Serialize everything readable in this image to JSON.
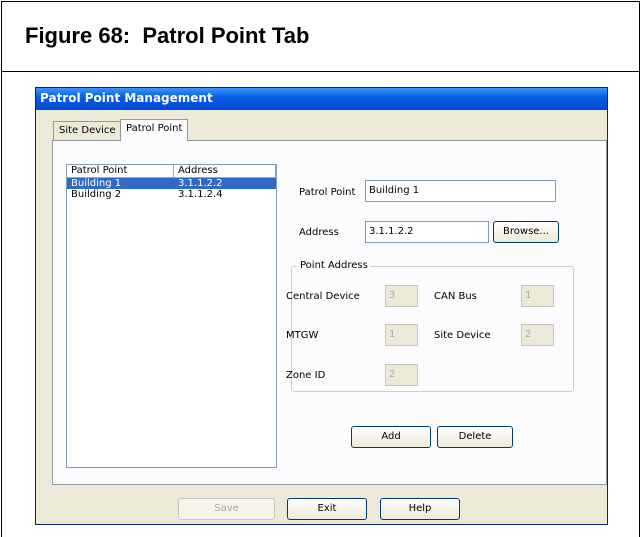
{
  "figure": {
    "title": "Figure 68:  Patrol Point Tab"
  },
  "window": {
    "title": "Patrol Point Management"
  },
  "tabs": [
    {
      "label": "Site Device",
      "active": false
    },
    {
      "label": "Patrol Point",
      "active": true
    }
  ],
  "list": {
    "columns": [
      "Patrol Point",
      "Address"
    ],
    "rows": [
      {
        "patrol_point": "Building 1",
        "address": "3.1.1.2.2",
        "selected": true
      },
      {
        "patrol_point": "Building 2",
        "address": "3.1.1.2.4",
        "selected": false
      }
    ]
  },
  "form": {
    "patrol_point_label": "Patrol Point",
    "patrol_point_value": "Building 1",
    "address_label": "Address",
    "address_value": "3.1.1.2.2",
    "browse_label": "Browse..."
  },
  "point_address": {
    "legend": "Point Address",
    "central_device_label": "Central Device",
    "central_device_value": "3",
    "can_bus_label": "CAN Bus",
    "can_bus_value": "1",
    "mtgw_label": "MTGW",
    "mtgw_value": "1",
    "site_device_label": "Site Device",
    "site_device_value": "2",
    "zone_id_label": "Zone ID",
    "zone_id_value": "2"
  },
  "actions": {
    "add_label": "Add",
    "delete_label": "Delete"
  },
  "footer": {
    "save_label": "Save",
    "exit_label": "Exit",
    "help_label": "Help"
  }
}
